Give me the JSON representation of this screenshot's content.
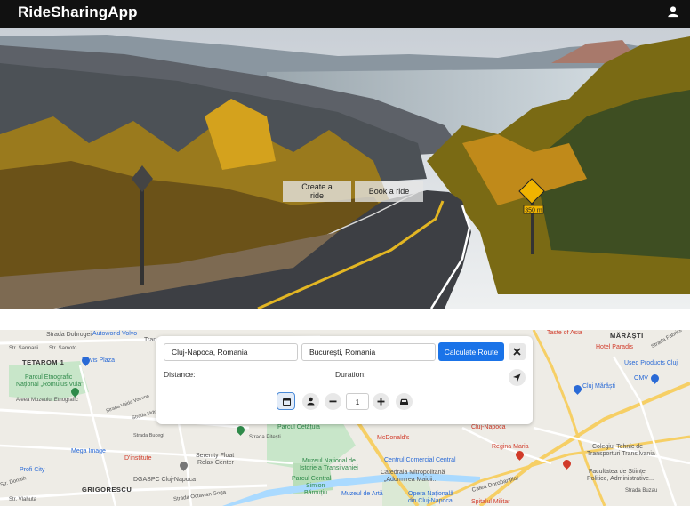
{
  "navbar": {
    "brand": "RideSharingApp",
    "user_icon": "user-icon"
  },
  "hero": {
    "create_label": "Create a ride",
    "book_label": "Book a ride",
    "speed_sign": "350 m"
  },
  "route_panel": {
    "from_value": "Cluj-Napoca, Romania",
    "to_value": "București, Romania",
    "calculate_label": "Calculate Route",
    "close_icon": "close-icon",
    "distance_label": "Distance:",
    "duration_label": "Duration:",
    "navigate_icon": "navigation-arrow-icon",
    "controls": {
      "calendar_icon": "calendar-icon",
      "person_icon": "person-icon",
      "minus_icon": "minus-icon",
      "quantity": "1",
      "plus_icon": "plus-icon",
      "car_icon": "car-icon"
    },
    "accent": "#1a73e8"
  },
  "map": {
    "labels": {
      "autoworld": "Autoworld Volvo",
      "stradia_dobrogei": "Strada Dobrogei",
      "str_sarmarii": "Str. Sarmarii",
      "str_samoto": "Str. Samoto",
      "tetarom": "TETAROM 1",
      "novis": "Novis Plaza",
      "parcul_etno": "Parcul Etnografic",
      "parcul_etno2": "Național „Romulus Vuia”",
      "aleea": "Aleea Muzeului Etnografic",
      "str_vaida": "Strada Vaida Voevod",
      "str_vidra": "Strada Vidraru",
      "str_bucegi": "Strada Bucegi",
      "mega_image": "Mega Image",
      "d_institute": "D'institute",
      "profi": "Profi City",
      "dgaspc": "DGASPC Cluj-Napoca",
      "grigorescu": "GRIGORESCU",
      "str_donath": "Str. Donath",
      "str_vlahuta": "Str. Vlahuta",
      "octavian_goga": "Strada Octavian Goga",
      "serenity": "Serenity Float",
      "serenity2": "Relax Center",
      "parcul_cetatuia": "Parcul Cetățuia",
      "str_pitesti": "Strada Pitești",
      "muzeul_istorie": "Muzeul Național de",
      "muzeul_istorie2": "Istorie a Transilvaniei",
      "parcul_central": "Parcul Central",
      "parcul_central2": "Simion",
      "parcul_central3": "Bărnuțiu",
      "muzeul_arta": "Muzeul de Artă",
      "mcdonalds": "McDonald's",
      "centrul_comercial": "Centrul Comercial Central",
      "catedrala": "Catedrala Mitropolitană",
      "catedrala2": "„Adormirea Maicii...",
      "opera": "Opera Națională",
      "opera2": "din Cluj-Napoca",
      "cluj_napoca": "Cluj-Napoca",
      "regina_maria": "Regina Maria",
      "calea_dorobantilor": "Calea Dorobanților",
      "spitalul": "Spitalul Militar",
      "taste_asia": "Taste of Asia",
      "marasti": "MĂRĂȘTI",
      "hotel_paradis": "Hotel Paradis",
      "used_products": "Used Products Cluj",
      "cluj_marasti": "Cluj Mărăști",
      "omv": "OMV",
      "colegiul": "Colegiul Tehnic de",
      "colegiul2": "Transporturi Transilvania",
      "facultatea": "Facultatea de Științe",
      "facultatea2": "Politice, Administrative...",
      "str_fabricii": "Strada Fabricii de",
      "str_buzau": "Strada Buzau",
      "tran": "Tran"
    }
  }
}
